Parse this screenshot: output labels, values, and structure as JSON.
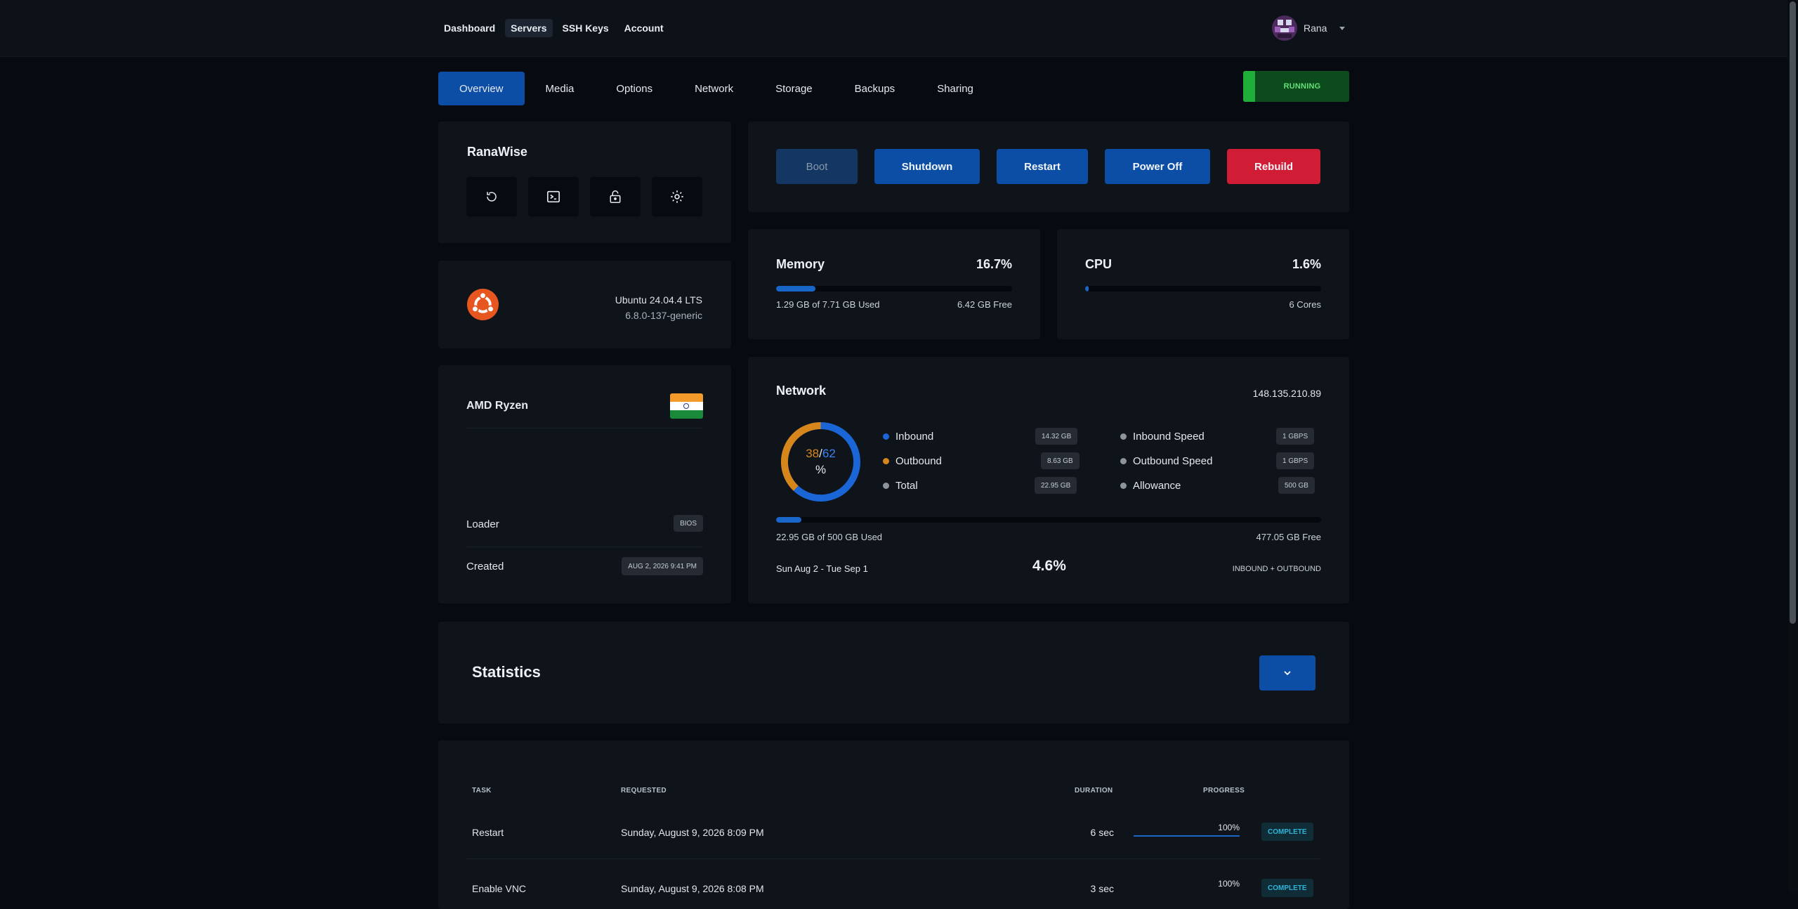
{
  "topnav": {
    "items": [
      {
        "label": "Dashboard",
        "active": false
      },
      {
        "label": "Servers",
        "active": true
      },
      {
        "label": "SSH Keys",
        "active": false
      },
      {
        "label": "Account",
        "active": false
      }
    ],
    "user_name": "Rana"
  },
  "tabs": [
    "Overview",
    "Media",
    "Options",
    "Network",
    "Storage",
    "Backups",
    "Sharing"
  ],
  "active_tab": "Overview",
  "status": {
    "label": "RUNNING",
    "color": "#1fae3a"
  },
  "server": {
    "name": "RanaWise",
    "actions": [
      "reload-icon",
      "console-icon",
      "lock-icon",
      "gear-icon"
    ]
  },
  "power": {
    "boot": "Boot",
    "shutdown": "Shutdown",
    "restart": "Restart",
    "power_off": "Power Off",
    "rebuild": "Rebuild"
  },
  "os": {
    "name": "Ubuntu 24.04.4 LTS",
    "kernel": "6.8.0-137-generic",
    "icon": "ubuntu-logo-icon"
  },
  "memory": {
    "title": "Memory",
    "percent": "16.7%",
    "used": "1.29 GB of 7.71 GB Used",
    "free": "6.42 GB Free",
    "fill_fraction": 0.167
  },
  "cpu": {
    "title": "CPU",
    "percent": "1.6%",
    "cores": "6 Cores",
    "fill_fraction": 0.016
  },
  "hardware": {
    "cpu_name": "AMD Ryzen",
    "flag": "india-flag-icon",
    "loader_label": "Loader",
    "loader_value": "BIOS",
    "created_label": "Created",
    "created_value": "AUG 2, 2026 9:41 PM"
  },
  "network": {
    "title": "Network",
    "ip": "148.135.210.89",
    "donut": {
      "inbound_pct": "38",
      "outbound_pct": "62",
      "unit": "%",
      "sep": "/",
      "inbound_fraction": 0.38,
      "outbound_fraction": 0.62
    },
    "legend": [
      {
        "label": "Inbound",
        "value": "14.32 GB",
        "color": "#1a66d6"
      },
      {
        "label": "Outbound",
        "value": "8.63 GB",
        "color": "#d7861b"
      },
      {
        "label": "Total",
        "value": "22.95 GB",
        "color": "#8e949c"
      }
    ],
    "speeds": [
      {
        "label": "Inbound Speed",
        "value": "1 GBPS"
      },
      {
        "label": "Outbound Speed",
        "value": "1 GBPS"
      },
      {
        "label": "Allowance",
        "value": "500 GB"
      }
    ],
    "used_text": "22.95 GB of 500 GB Used",
    "free_text": "477.05 GB Free",
    "usage_fraction": 0.046,
    "period": "Sun Aug 2 - Tue Sep 1",
    "period_percent": "4.6%",
    "scope": "INBOUND + OUTBOUND"
  },
  "statistics": {
    "title": "Statistics"
  },
  "tasks": {
    "headers": {
      "task": "TASK",
      "requested": "REQUESTED",
      "duration": "DURATION",
      "progress": "PROGRESS"
    },
    "rows": [
      {
        "task": "Restart",
        "requested": "Sunday, August 9, 2026 8:09 PM",
        "duration": "6 sec",
        "progress": "100%",
        "status": "COMPLETE"
      },
      {
        "task": "Enable VNC",
        "requested": "Sunday, August 9, 2026 8:08 PM",
        "duration": "3 sec",
        "progress": "100%",
        "status": "COMPLETE"
      }
    ]
  }
}
